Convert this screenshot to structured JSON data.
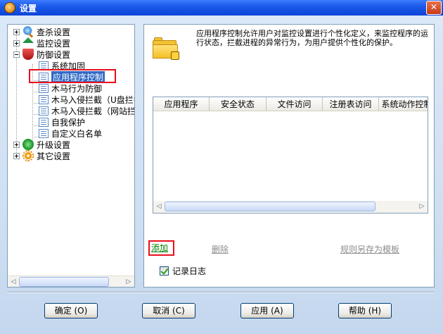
{
  "window": {
    "title": "设置",
    "close_glyph": "✕"
  },
  "tree": {
    "nodes": [
      {
        "label": "查杀设置",
        "icon": "scan-icon",
        "expander": "plus"
      },
      {
        "label": "监控设置",
        "icon": "umbrella-icon",
        "expander": "plus"
      },
      {
        "label": "防御设置",
        "icon": "shield-icon",
        "expander": "minus"
      },
      {
        "label": "升级设置",
        "icon": "upgrade-icon",
        "expander": "plus"
      },
      {
        "label": "其它设置",
        "icon": "gear-icon",
        "expander": "plus"
      }
    ],
    "defense_children": [
      "系统加固",
      "应用程序控制",
      "木马行为防御",
      "木马入侵拦截（U盘拦截）",
      "木马入侵拦截（网站拦截）",
      "自我保护",
      "自定义白名单"
    ],
    "selected": "应用程序控制"
  },
  "main": {
    "description": "应用程序控制允许用户对监控设置进行个性化定义，来监控程序的运行状态，拦截进程的异常行为，为用户提供个性化的保护。",
    "columns": [
      "应用程序",
      "安全状态",
      "文件访问",
      "注册表访问",
      "系统动作控制"
    ],
    "rows": [],
    "add_link": "添加",
    "delete_link": "删除",
    "save_template_link": "规则另存为模板",
    "log_checkbox": {
      "label": "记录日志",
      "checked": true
    }
  },
  "buttons": {
    "ok": "确定 (O)",
    "cancel": "取消 (C)",
    "apply": "应用 (A)",
    "help": "帮助 (H)"
  }
}
